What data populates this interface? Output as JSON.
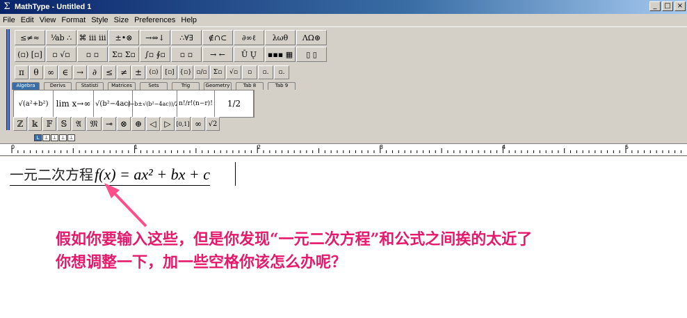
{
  "window": {
    "title": "MathType - Untitled 1",
    "buttons": [
      "_",
      "□",
      "×"
    ]
  },
  "menu": [
    "File",
    "Edit",
    "View",
    "Format",
    "Style",
    "Size",
    "Preferences",
    "Help"
  ],
  "palette_row1": [
    "≤≠≈",
    "⅟ab ∴",
    "⌘ ⅲ ⅲ",
    "±•⊗",
    "→⇔↓",
    "∴∀∃",
    "∉∩⊂",
    "∂∞ℓ",
    "λωθ",
    "ΛΩ⊛"
  ],
  "palette_row2": [
    "(▫) [▫]",
    "▫ √▫",
    "▫ ▫",
    "Σ▫ Σ▫",
    "∫▫ ∮▫",
    "▫ ▫",
    "→ ←",
    "Ū Ų",
    "▪▪▪ ▦",
    "▯ ▯"
  ],
  "small_row": [
    "π",
    "θ",
    "∞",
    "∈",
    "→",
    "∂",
    "≤",
    "≠",
    "±",
    "(▫)",
    "[▫]",
    "{▫}",
    "▫/▫",
    "Σ▫",
    "√▫",
    "▫",
    "▫.",
    "▫."
  ],
  "tabs": [
    "Algebra",
    "Derivs",
    "Statisti",
    "Matrices",
    "Sets",
    "Trig",
    "Geometry",
    "Tab 8",
    "Tab 9"
  ],
  "templates": [
    "√(a²+b²)",
    "lim x→∞",
    "√(b²−4ac)",
    "(−b±√(b²−4ac))/2a",
    "n!/r!(n−r)!",
    "1/2"
  ],
  "bottom_row": [
    "ℤ",
    "𝕜",
    "𝔽",
    "𝕊",
    "𝔄",
    "𝔐",
    "⊸",
    "⊗",
    "⊕",
    "◁",
    "▷",
    "[0,1]",
    "∞",
    "√2"
  ],
  "tab_stops": [
    "L",
    "⊥",
    "⊥",
    "⊥",
    "⊥"
  ],
  "ruler": [
    "0",
    "1",
    "2",
    "3",
    "4",
    "5"
  ],
  "equation": {
    "chinese": "一元二次方程",
    "formula": "f(x) = ax² + bx + c"
  },
  "annotation": {
    "line1": "假如你要输入这些，但是你发现“一元二次方程”和公式之间挨的太近了",
    "line2": "你想调整一下，加一些空格你该怎么办呢？"
  },
  "colors": {
    "annotation": "#e6186b",
    "titlebar": "#0a246a"
  }
}
